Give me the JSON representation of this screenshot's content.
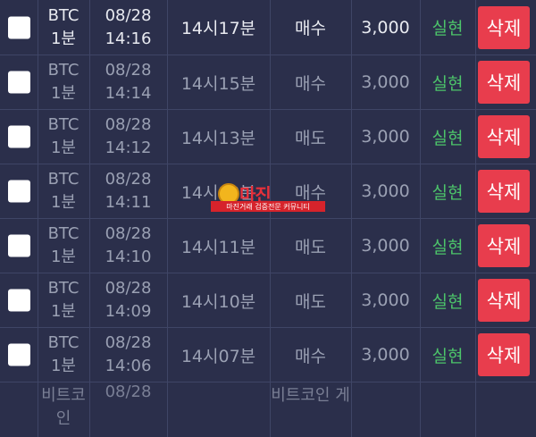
{
  "rows": [
    {
      "symbol": "BTC",
      "interval": "1분",
      "date": "08/28",
      "time": "14:16",
      "round": "14시17분",
      "side": "매수",
      "amount": "3,000",
      "status": "실현",
      "delete_label": "삭제",
      "highlight": true
    },
    {
      "symbol": "BTC",
      "interval": "1분",
      "date": "08/28",
      "time": "14:14",
      "round": "14시15분",
      "side": "매수",
      "amount": "3,000",
      "status": "실현",
      "delete_label": "삭제",
      "highlight": false
    },
    {
      "symbol": "BTC",
      "interval": "1분",
      "date": "08/28",
      "time": "14:12",
      "round": "14시13분",
      "side": "매도",
      "amount": "3,000",
      "status": "실현",
      "delete_label": "삭제",
      "highlight": false
    },
    {
      "symbol": "BTC",
      "interval": "1분",
      "date": "08/28",
      "time": "14:11",
      "round": "14시12분",
      "side": "매수",
      "amount": "3,000",
      "status": "실현",
      "delete_label": "삭제",
      "highlight": false
    },
    {
      "symbol": "BTC",
      "interval": "1분",
      "date": "08/28",
      "time": "14:10",
      "round": "14시11분",
      "side": "매도",
      "amount": "3,000",
      "status": "실현",
      "delete_label": "삭제",
      "highlight": false
    },
    {
      "symbol": "BTC",
      "interval": "1분",
      "date": "08/28",
      "time": "14:09",
      "round": "14시10분",
      "side": "매도",
      "amount": "3,000",
      "status": "실현",
      "delete_label": "삭제",
      "highlight": false
    },
    {
      "symbol": "BTC",
      "interval": "1분",
      "date": "08/28",
      "time": "14:06",
      "round": "14시07분",
      "side": "매수",
      "amount": "3,000",
      "status": "실현",
      "delete_label": "삭제",
      "highlight": false
    }
  ],
  "partial_row": {
    "symbol": "비트코인",
    "date": "08/28",
    "round": "비트코인 게"
  },
  "watermark": {
    "title": "마진",
    "tagline": "마진거래 검증전문 커뮤니티"
  },
  "colors": {
    "background": "#2b2f4b",
    "grid": "#3f4566",
    "status": "#4cc46a",
    "delete": "#e83d4d"
  }
}
